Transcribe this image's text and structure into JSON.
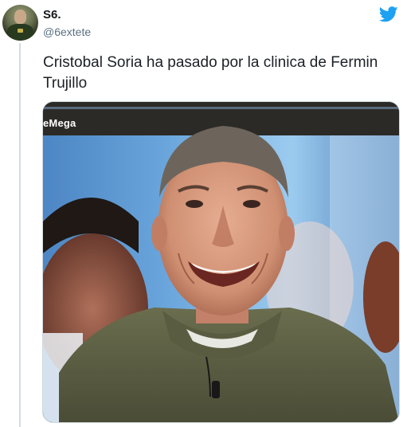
{
  "tweet": {
    "author_name": "S6.",
    "author_handle": "@6extete",
    "text": "Cristobal Soria ha pasado por la clinica de Fermin Trujillo",
    "media": {
      "overlay_text": "eMega",
      "description_icon": "photo"
    }
  },
  "icons": {
    "logo": "twitter-bird-icon",
    "avatar": "avatar"
  },
  "colors": {
    "brand": "#1da1f2",
    "handle": "#5b7083",
    "name": "#14171a",
    "thread_line": "#d3dde3"
  }
}
